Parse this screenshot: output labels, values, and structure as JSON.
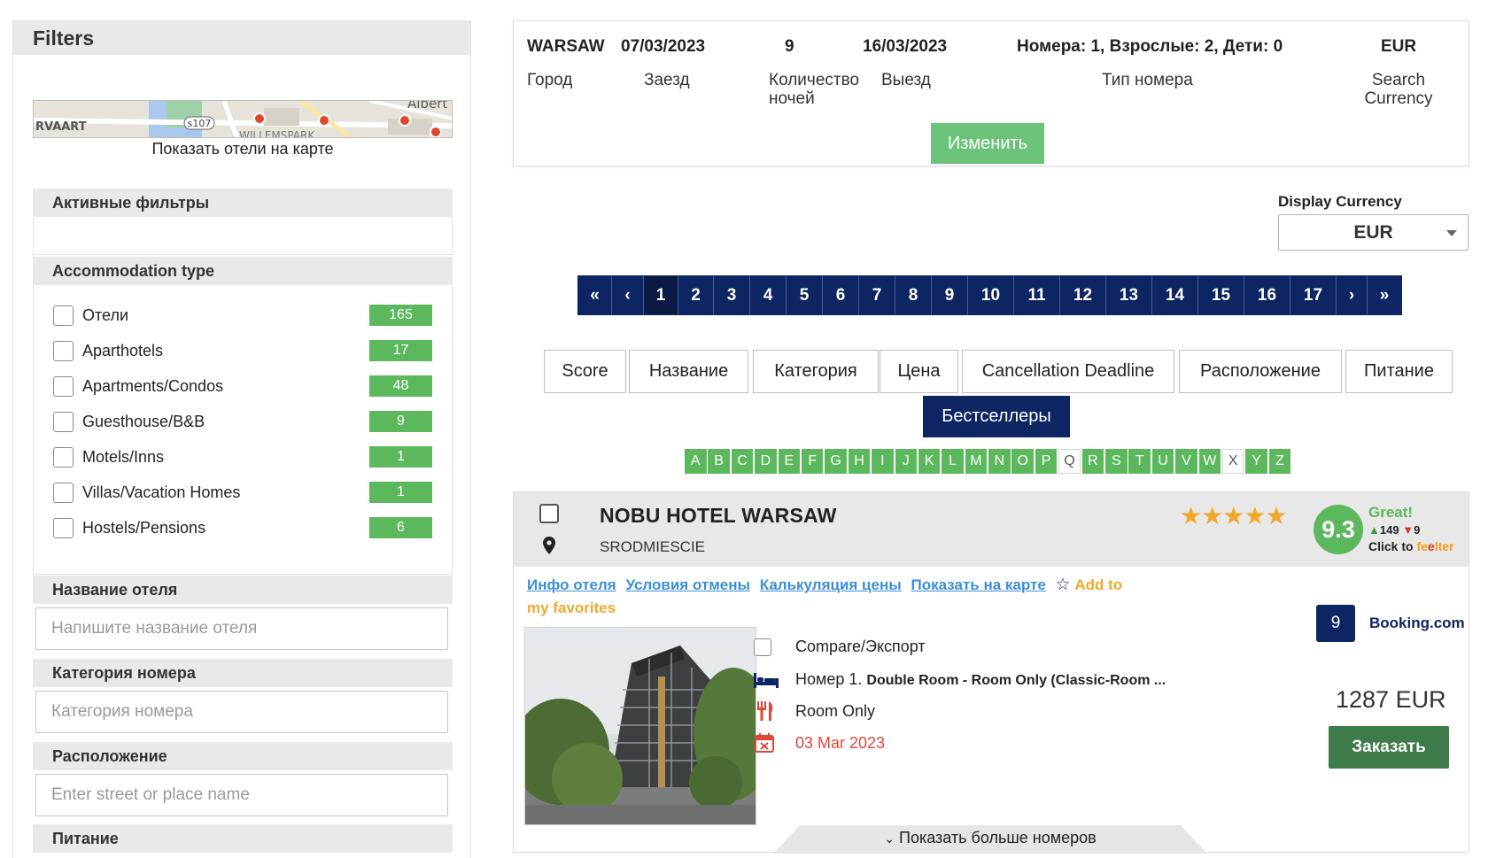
{
  "sidebar": {
    "title": "Filters",
    "map_caption": "Показать отели на карте",
    "map_labels": {
      "left": "RVAART",
      "road": "s107",
      "district": "WILLEMSPARK",
      "right": "Albert"
    },
    "active_filters_title": "Активные фильтры",
    "accommodation_title": "Accommodation type",
    "accommodation": [
      {
        "label": "Отели",
        "count": "165"
      },
      {
        "label": "Aparthotels",
        "count": "17"
      },
      {
        "label": "Apartments/Condos",
        "count": "48"
      },
      {
        "label": "Guesthouse/B&B",
        "count": "9"
      },
      {
        "label": "Motels/Inns",
        "count": "1"
      },
      {
        "label": "Villas/Vacation Homes",
        "count": "1"
      },
      {
        "label": "Hostels/Pensions",
        "count": "6"
      }
    ],
    "hotel_name": {
      "title": "Название отеля",
      "placeholder": "Напишите название отеля"
    },
    "room_category": {
      "title": "Категория номера",
      "placeholder": "Категория номера"
    },
    "location": {
      "title": "Расположение",
      "placeholder": "Enter street or place name"
    },
    "meals_title": "Питание"
  },
  "summary": {
    "city_value": "WARSAW",
    "city_label": "Город",
    "checkin_value": "07/03/2023",
    "checkin_label": "Заезд",
    "nights_value": "9",
    "nights_label_1": "Количество",
    "nights_label_2": "ночей",
    "checkout_value": "16/03/2023",
    "checkout_label": "Выезд",
    "rooms_value": "Номера: 1, Взрослые: 2, Дети: 0",
    "rooms_label": "Тип номера",
    "currency_value": "EUR",
    "currency_label_1": "Search",
    "currency_label_2": "Currency",
    "change_button": "Изменить"
  },
  "display_currency": {
    "label": "Display Currency",
    "value": "EUR"
  },
  "pagination": {
    "first": "«",
    "prev": "‹",
    "next": "›",
    "last": "»",
    "pages": [
      "1",
      "2",
      "3",
      "4",
      "5",
      "6",
      "7",
      "8",
      "9",
      "10",
      "11",
      "12",
      "13",
      "14",
      "15",
      "16",
      "17"
    ],
    "current": "1"
  },
  "sort": {
    "score": "Score",
    "name": "Название",
    "category": "Категория",
    "price": "Цена",
    "cancellation": "Cancellation Deadline",
    "location": "Расположение",
    "meals": "Питание",
    "bestsellers": "Бестселлеры"
  },
  "alphabet": [
    "A",
    "B",
    "C",
    "D",
    "E",
    "F",
    "G",
    "H",
    "I",
    "J",
    "K",
    "L",
    "M",
    "N",
    "O",
    "P",
    "Q",
    "R",
    "S",
    "T",
    "U",
    "V",
    "W",
    "X",
    "Y",
    "Z"
  ],
  "alphabet_disabled": [
    "Q",
    "X"
  ],
  "hotel": {
    "name": "NOBU HOTEL WARSAW",
    "area": "SRODMIESCIE",
    "stars": "★★★★★",
    "score": "9.3",
    "score_word": "Great!",
    "votes_up": "149",
    "votes_down": "9",
    "click_to": "Click to ",
    "feelter_1": "fe",
    "feelter_2": "e",
    "feelter_3": "lter",
    "links": {
      "info": "Инфо отеля",
      "cancellation": "Условия отмены",
      "price_calc": "Калькуляция цены",
      "show_map": "Показать на карте",
      "favorites": "Add to my favorites"
    },
    "booking_score": "9",
    "booking_source": "Booking.com",
    "compare_label": "Compare/Экспорт",
    "room_prefix": "Номер 1. ",
    "room_name": "Double Room - Room Only (Classic-Room ...",
    "meal": "Room Only",
    "deadline": "03 Mar 2023",
    "price": "1287 EUR",
    "book_button": "Заказать",
    "more_rooms": "Показать больше номеров"
  },
  "colors": {
    "navy": "#0d2563",
    "green_badge": "#5cb85c",
    "change_button": "#6cc47a",
    "book_button": "#3d7b4a",
    "link_blue": "#3b8fd6",
    "star_gold": "#f0a82c",
    "deadline_red": "#e0453a"
  }
}
